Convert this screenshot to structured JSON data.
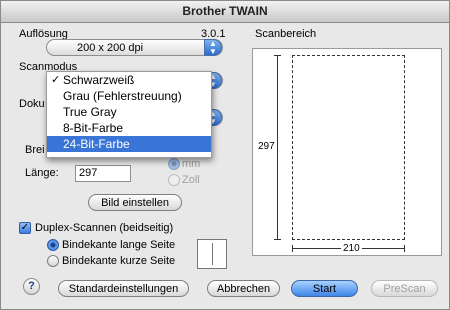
{
  "window": {
    "title": "Brother TWAIN"
  },
  "resolution": {
    "label": "Auflösung",
    "version": "3.0.1",
    "value": "200 x 200 dpi"
  },
  "scan_area": {
    "label": "Scanbereich",
    "height_value": "297",
    "width_value": "210"
  },
  "scan_mode": {
    "label": "Scanmodus",
    "options": [
      "Schwarzweiß",
      "Grau (Fehlerstreuung)",
      "True Gray",
      "8-Bit-Farbe",
      "24-Bit-Farbe"
    ],
    "checked_option": "Schwarzweiß",
    "highlighted_option": "24-Bit-Farbe"
  },
  "document": {
    "label_partial": "Doku"
  },
  "size": {
    "width_label_partial": "Brei",
    "length_label": "Länge:",
    "length_value": "297",
    "unit_mm": "mm",
    "unit_inch": "Zoll",
    "selected_unit": "mm"
  },
  "buttons": {
    "adjust_image": "Bild einstellen",
    "defaults": "Standardeinstellungen",
    "cancel": "Abbrechen",
    "start": "Start",
    "prescan": "PreScan",
    "help": "?"
  },
  "duplex": {
    "label": "Duplex-Scannen (beidseitig)",
    "checked": true,
    "options": [
      "Bindekante lange Seite",
      "Bindekante kurze Seite"
    ],
    "selected": "Bindekante lange Seite"
  }
}
